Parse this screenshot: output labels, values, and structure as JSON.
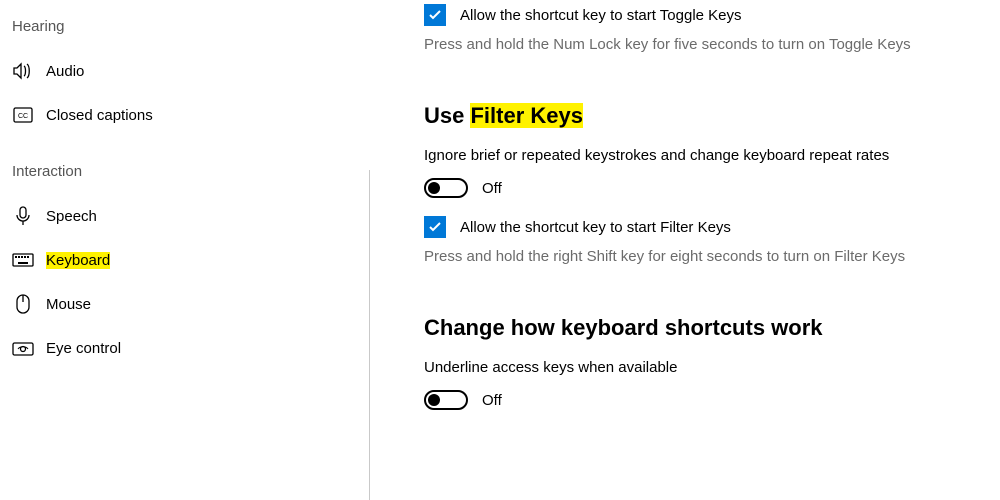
{
  "sidebar": {
    "groups": [
      {
        "header": "Hearing",
        "items": [
          {
            "icon": "audio",
            "label": "Audio"
          },
          {
            "icon": "cc",
            "label": "Closed captions"
          }
        ]
      },
      {
        "header": "Interaction",
        "items": [
          {
            "icon": "speech",
            "label": "Speech"
          },
          {
            "icon": "keyboard",
            "label": "Keyboard",
            "highlight": true,
            "selected": true
          },
          {
            "icon": "mouse",
            "label": "Mouse"
          },
          {
            "icon": "eye",
            "label": "Eye control"
          }
        ]
      }
    ]
  },
  "main": {
    "toggleKeys": {
      "checkboxLabel": "Allow the shortcut key to start Toggle Keys",
      "checkboxChecked": true,
      "desc": "Press and hold the Num Lock key for five seconds to turn on Toggle Keys"
    },
    "filterKeys": {
      "heading_pre": "Use ",
      "heading_hl": "Filter Keys",
      "desc": "Ignore brief or repeated keystrokes and change keyboard repeat rates",
      "toggleState": "Off",
      "checkboxLabel": "Allow the shortcut key to start Filter Keys",
      "checkboxChecked": true,
      "checkboxDesc": "Press and hold the right Shift key for eight seconds to turn on Filter Keys"
    },
    "shortcuts": {
      "heading": "Change how keyboard shortcuts work",
      "underlineLabel": "Underline access keys when available",
      "underlineState": "Off"
    }
  }
}
